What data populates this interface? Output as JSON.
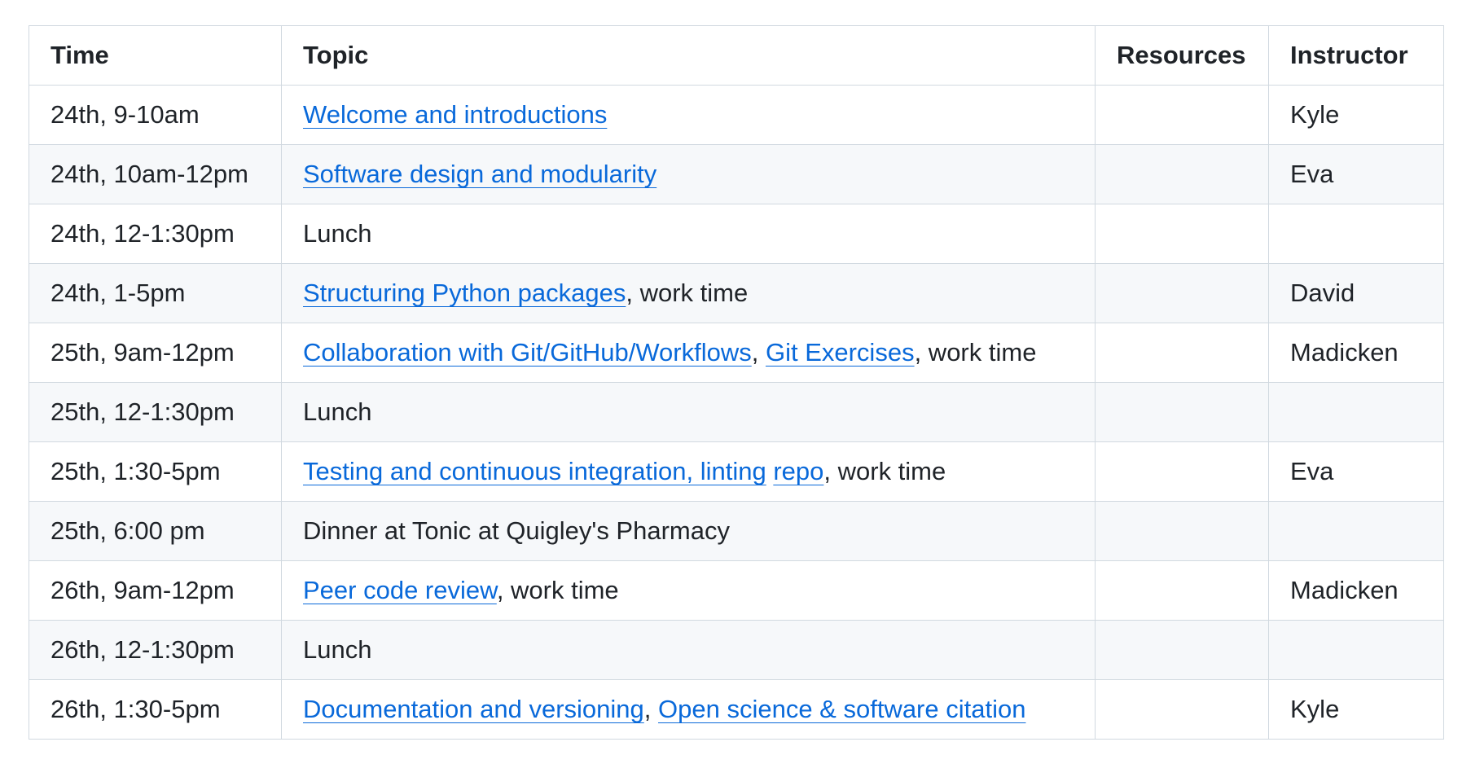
{
  "table": {
    "headers": {
      "time": "Time",
      "topic": "Topic",
      "resources": "Resources",
      "instructor": "Instructor"
    },
    "rows": [
      {
        "time": "24th, 9-10am",
        "topic": [
          {
            "text": "Welcome and introductions",
            "link": true
          }
        ],
        "resources": "",
        "instructor": "Kyle"
      },
      {
        "time": "24th, 10am-12pm",
        "topic": [
          {
            "text": "Software design and modularity",
            "link": true
          }
        ],
        "resources": "",
        "instructor": "Eva"
      },
      {
        "time": "24th, 12-1:30pm",
        "topic": [
          {
            "text": "Lunch",
            "link": false
          }
        ],
        "resources": "",
        "instructor": ""
      },
      {
        "time": "24th, 1-5pm",
        "topic": [
          {
            "text": "Structuring Python packages",
            "link": true
          },
          {
            "text": ", work time",
            "link": false
          }
        ],
        "resources": "",
        "instructor": "David"
      },
      {
        "time": "25th, 9am-12pm",
        "topic": [
          {
            "text": "Collaboration with Git/GitHub/Workflows",
            "link": true
          },
          {
            "text": ", ",
            "link": false
          },
          {
            "text": "Git Exercises",
            "link": true
          },
          {
            "text": ", work time",
            "link": false
          }
        ],
        "resources": "",
        "instructor": "Madicken"
      },
      {
        "time": "25th, 12-1:30pm",
        "topic": [
          {
            "text": "Lunch",
            "link": false
          }
        ],
        "resources": "",
        "instructor": ""
      },
      {
        "time": "25th, 1:30-5pm",
        "topic": [
          {
            "text": "Testing and continuous integration, linting",
            "link": true
          },
          {
            "text": " ",
            "link": false
          },
          {
            "text": "repo",
            "link": true
          },
          {
            "text": ", work time",
            "link": false
          }
        ],
        "resources": "",
        "instructor": "Eva"
      },
      {
        "time": "25th, 6:00 pm",
        "topic": [
          {
            "text": "Dinner at Tonic at Quigley's Pharmacy",
            "link": false
          }
        ],
        "resources": "",
        "instructor": ""
      },
      {
        "time": "26th, 9am-12pm",
        "topic": [
          {
            "text": "Peer code review",
            "link": true
          },
          {
            "text": ", work time",
            "link": false
          }
        ],
        "resources": "",
        "instructor": "Madicken"
      },
      {
        "time": "26th, 12-1:30pm",
        "topic": [
          {
            "text": "Lunch",
            "link": false
          }
        ],
        "resources": "",
        "instructor": ""
      },
      {
        "time": "26th, 1:30-5pm",
        "topic": [
          {
            "text": "Documentation and versioning",
            "link": true
          },
          {
            "text": ", ",
            "link": false
          },
          {
            "text": "Open science & software citation",
            "link": true
          }
        ],
        "resources": "",
        "instructor": "Kyle"
      }
    ]
  },
  "colors": {
    "text": "#1f2328",
    "link": "#0969da",
    "border": "#d1d9e0",
    "stripe": "#f6f8fa"
  }
}
